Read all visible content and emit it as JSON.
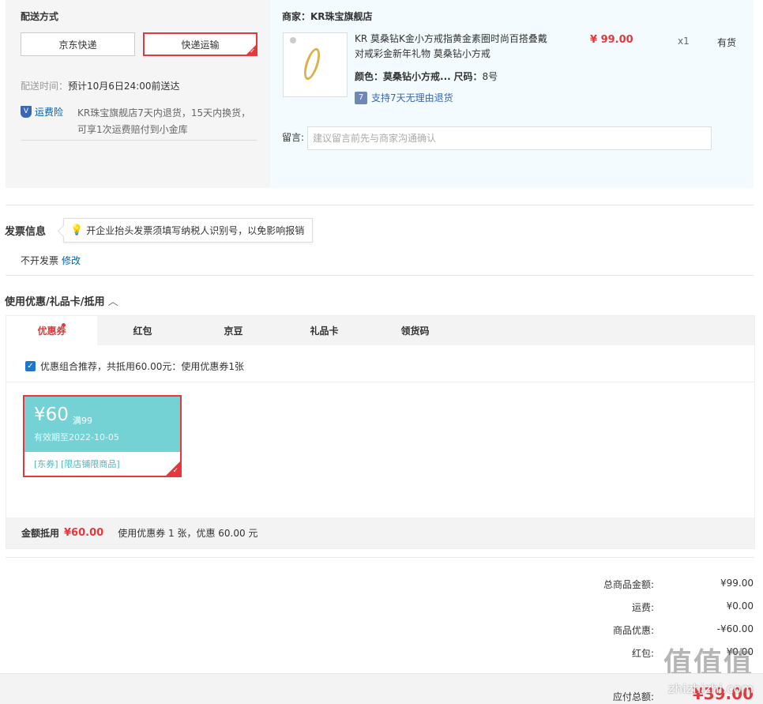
{
  "shipping": {
    "title": "配送方式",
    "options": [
      "京东快递",
      "快递运输"
    ],
    "selected_check": "✓",
    "time_label": "配送时间：",
    "time_value": "预计10月6日24:00前送达",
    "insurance_label": "运费险",
    "insurance_icon_text": "V",
    "insurance_desc": "KR珠宝旗舰店7天内退货，15天内换货，可享1次运费赔付到小金库"
  },
  "order": {
    "shop_label": "商家：KR珠宝旗舰店",
    "product_title": "KR 莫桑钻K金小方戒指黄金素圈时尚百搭叠戴对戒彩金新年礼物 莫桑钻小方戒",
    "price": "¥ 99.00",
    "qty": "x1",
    "stock": "有货",
    "color_key": "颜色：",
    "color_value": "莫桑钻小方戒...",
    "size_key": "尺码：",
    "size_value": "8号",
    "return_icon_text": "7",
    "return_text": "支持7天无理由退货",
    "message_label": "留言:",
    "message_placeholder": "建议留言前先与商家沟通确认"
  },
  "invoice": {
    "title": "发票信息",
    "tip": "开企业抬头发票须填写纳税人识别号，以免影响报销",
    "status": "不开发票",
    "edit_label": "修改"
  },
  "coupons": {
    "title": "使用优惠/礼品卡/抵用",
    "collapse_glyph": "︿",
    "tabs": [
      "优惠券",
      "红包",
      "京豆",
      "礼品卡",
      "领货码"
    ],
    "combo_text": "优惠组合推荐，共抵用60.00元：使用优惠券1张",
    "coupon": {
      "amount": "¥60",
      "condition": "满99",
      "expiry": "有效期至2022-10-05",
      "tags": "[东券] [限店铺限商品]"
    },
    "footer_label": "金额抵用",
    "footer_amount": "¥60.00",
    "footer_desc": "使用优惠券 1 张，优惠 60.00 元"
  },
  "summary": {
    "rows": [
      {
        "label": "总商品金额:",
        "value": "¥99.00"
      },
      {
        "label": "运费:",
        "value": "¥0.00"
      },
      {
        "label": "商品优惠:",
        "value": "-¥60.00"
      },
      {
        "label": "红包:",
        "value": "¥0.00"
      }
    ],
    "total_label": "应付总额:",
    "total_value": "¥39.00"
  },
  "watermark": {
    "big": "值值值",
    "url": "zhizhizhi.com"
  },
  "colors": {
    "accent": "#e4393c",
    "coupon": "#74d2d4",
    "link": "#005ea7"
  }
}
